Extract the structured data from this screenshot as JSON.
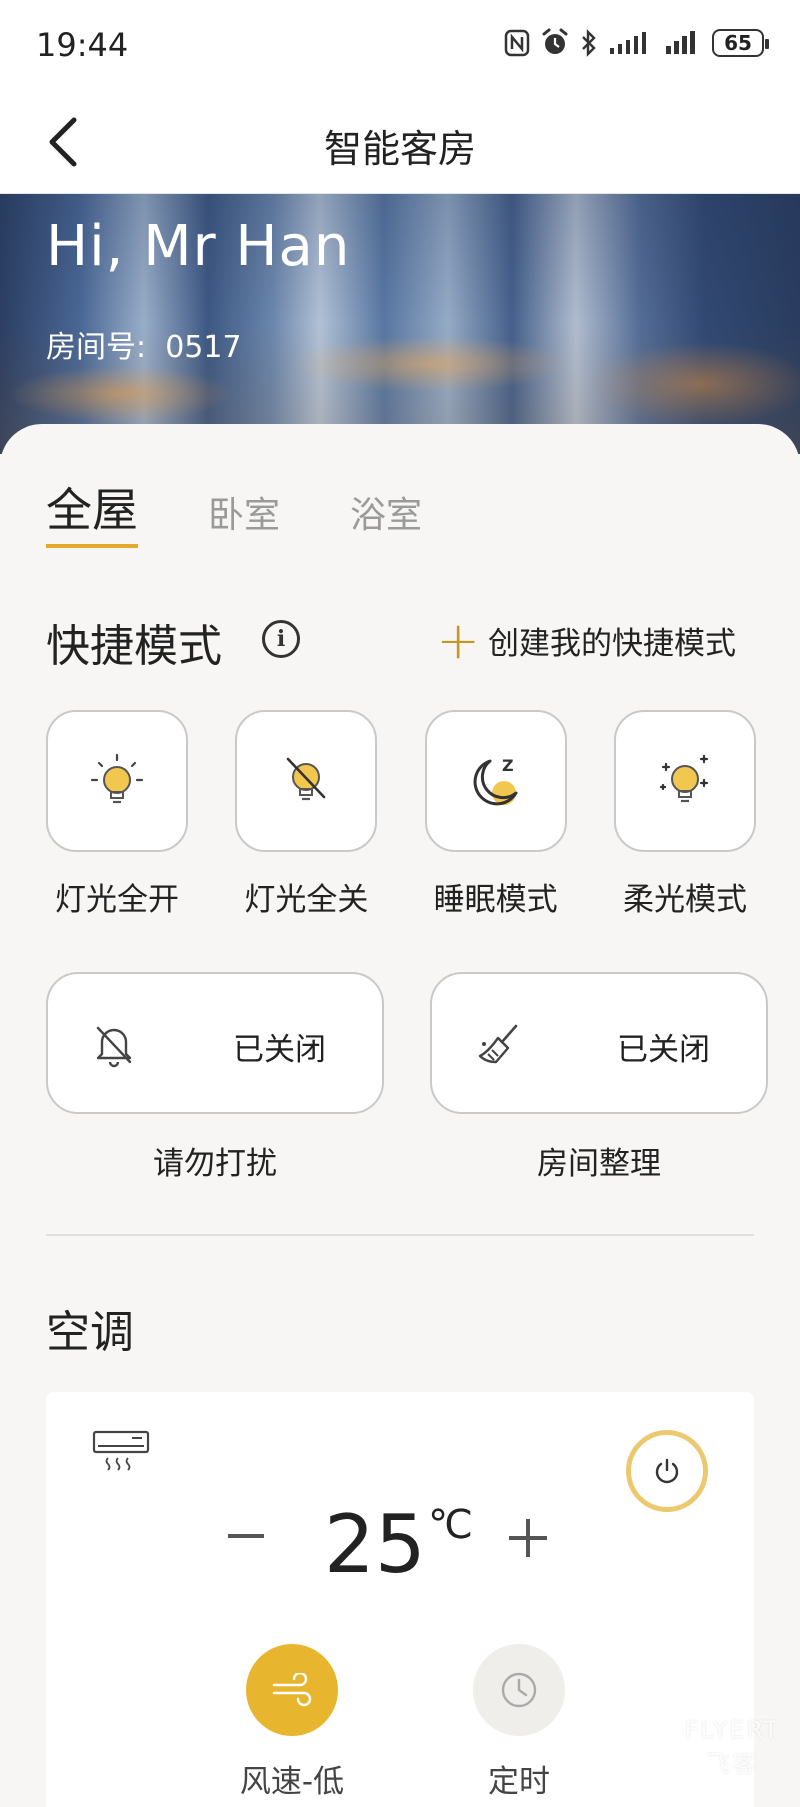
{
  "status_bar": {
    "time": "19:44",
    "battery": "65"
  },
  "nav": {
    "title": "智能客房"
  },
  "hero": {
    "greeting": "Hi, Mr Han",
    "room_label": "房间号:",
    "room_number": "0517"
  },
  "tabs": [
    {
      "label": "全屋",
      "active": true
    },
    {
      "label": "卧室",
      "active": false
    },
    {
      "label": "浴室",
      "active": false
    }
  ],
  "quick_modes": {
    "title": "快捷模式",
    "create_label": "创建我的快捷模式",
    "items": [
      {
        "label": "灯光全开",
        "icon": "bulb-on-icon"
      },
      {
        "label": "灯光全关",
        "icon": "bulb-off-icon"
      },
      {
        "label": "睡眠模式",
        "icon": "moon-sleep-icon"
      },
      {
        "label": "柔光模式",
        "icon": "soft-light-icon"
      }
    ]
  },
  "services": [
    {
      "label": "请勿打扰",
      "status": "已关闭",
      "icon": "bell-off-icon"
    },
    {
      "label": "房间整理",
      "status": "已关闭",
      "icon": "broom-icon"
    }
  ],
  "ac": {
    "title": "空调",
    "temperature": "25",
    "unit": "℃",
    "fan_label": "风速-低",
    "timer_label": "定时"
  },
  "watermark": {
    "line1": "FLYERT",
    "line2": "飞客"
  },
  "colors": {
    "accent": "#e3a92a",
    "gold_light": "#ecc86e",
    "fan_button": "#e7b52e"
  }
}
